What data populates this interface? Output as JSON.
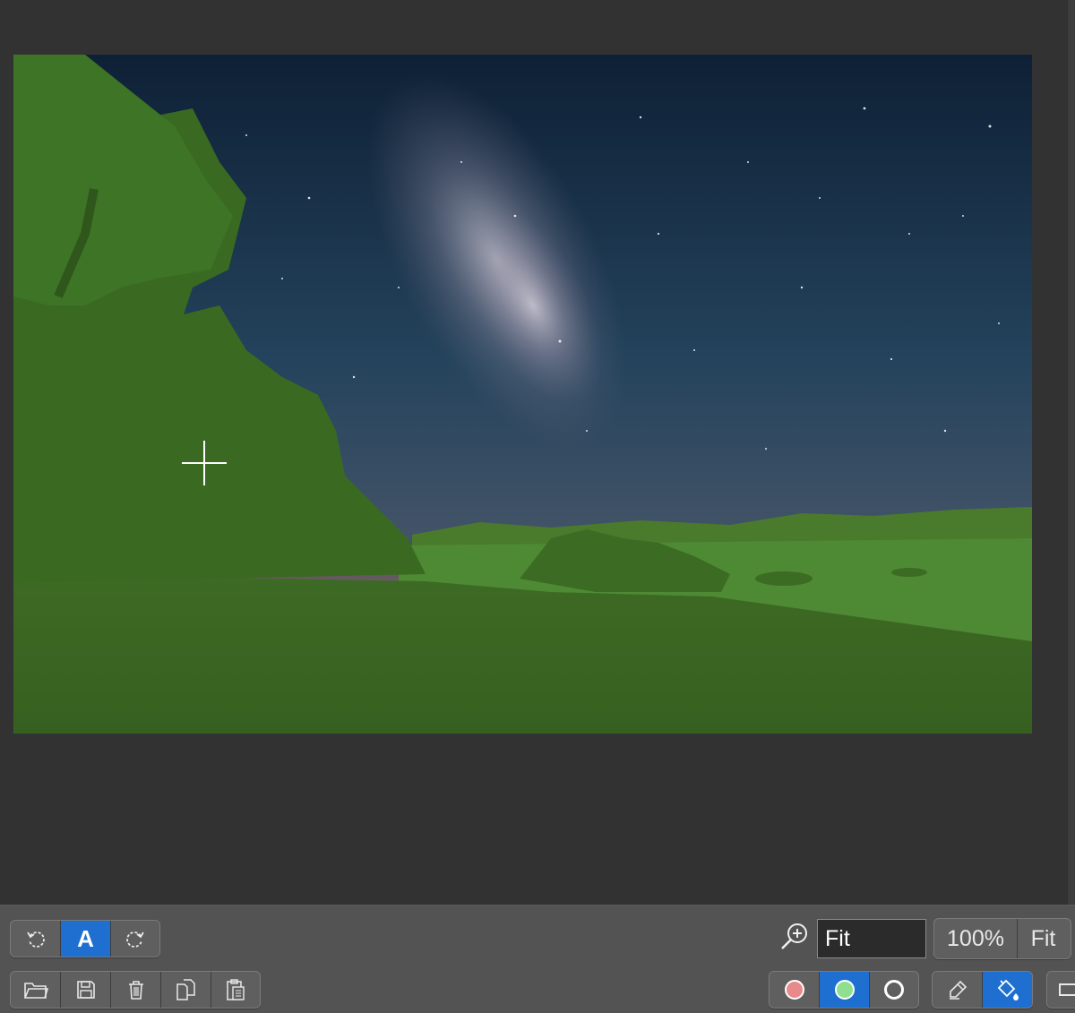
{
  "canvas": {
    "image_description_icon": "night-sky-photo",
    "overlay_color": "#3f7a1f"
  },
  "toolbar_top": {
    "rotate_left_icon": "rotate-ccw-icon",
    "auto_label": "A",
    "rotate_right_icon": "rotate-cw-icon"
  },
  "toolbar_bottom": {
    "icons": [
      "folder-icon",
      "save-icon",
      "trash-icon",
      "copy-icon",
      "paste-icon"
    ]
  },
  "zoom": {
    "field_value": "Fit",
    "percent_label": "100%",
    "fit_label": "Fit"
  },
  "mask": {
    "colors": {
      "background": "#e88a8a",
      "foreground": "#8ee08e",
      "unknown": "#ffffff"
    },
    "selected": "foreground"
  },
  "tools": {
    "selected": "fill"
  },
  "colors": {
    "accent": "#1f6fd0",
    "toolbar_bg": "#535353",
    "canvas_bg": "#323232"
  }
}
